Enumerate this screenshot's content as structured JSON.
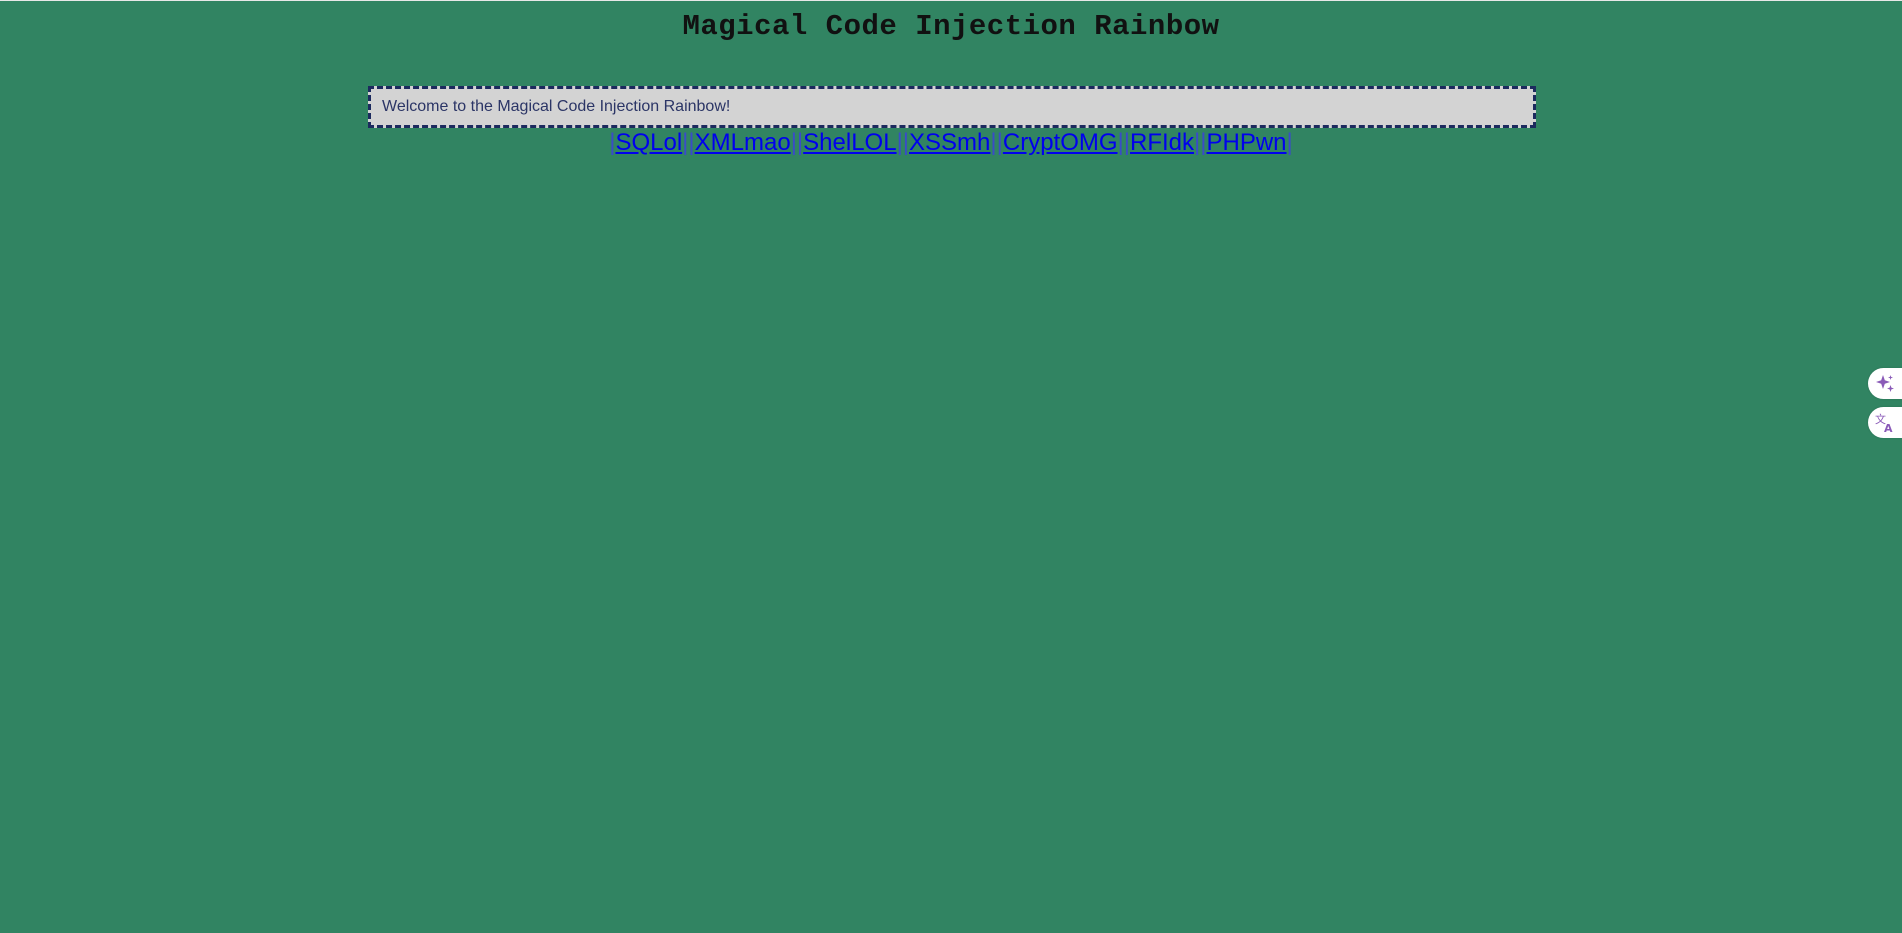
{
  "page": {
    "title": "Magical Code Injection Rainbow",
    "welcome": "Welcome to the Magical Code Injection Rainbow!"
  },
  "nav": {
    "separator": "|",
    "links": [
      {
        "label": "SQLol"
      },
      {
        "label": "XMLmao"
      },
      {
        "label": "ShelLOL"
      },
      {
        "label": "XSSmh"
      },
      {
        "label": "CryptOMG"
      },
      {
        "label": "RFIdk"
      },
      {
        "label": "PHPwn"
      }
    ]
  },
  "side_widgets": {
    "ai": {
      "icon": "sparkle-icon"
    },
    "translate": {
      "icon": "translate-icon"
    }
  },
  "colors": {
    "background": "#318462",
    "welcome_box": "#d3d3d3",
    "link": "#0000ee",
    "icon_accent": "#8a5ab8"
  }
}
